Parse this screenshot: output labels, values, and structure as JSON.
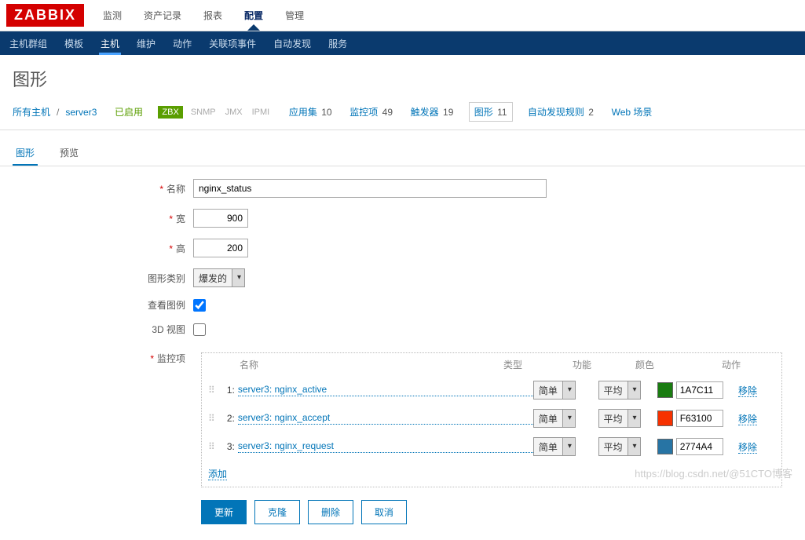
{
  "logo": "ZABBIX",
  "topnav": {
    "items": [
      "监测",
      "资产记录",
      "报表",
      "配置",
      "管理"
    ],
    "active_index": 3
  },
  "subnav": {
    "items": [
      "主机群组",
      "模板",
      "主机",
      "维护",
      "动作",
      "关联项事件",
      "自动发现",
      "服务"
    ],
    "active_index": 2
  },
  "page_title": "图形",
  "breadcrumb": {
    "all_hosts": "所有主机",
    "host": "server3",
    "state": "已启用",
    "tags": {
      "zbx": "ZBX",
      "snmp": "SNMP",
      "jmx": "JMX",
      "ipmi": "IPMI"
    },
    "counts": [
      {
        "label": "应用集",
        "value": "10"
      },
      {
        "label": "监控项",
        "value": "49"
      },
      {
        "label": "触发器",
        "value": "19"
      },
      {
        "label": "图形",
        "value": "11",
        "active": true
      },
      {
        "label": "自动发现规则",
        "value": "2"
      },
      {
        "label": "Web 场景",
        "value": ""
      }
    ]
  },
  "tabs": {
    "items": [
      "图形",
      "预览"
    ],
    "active_index": 0
  },
  "form": {
    "name_label": "名称",
    "name_value": "nginx_status",
    "width_label": "宽",
    "width_value": "900",
    "height_label": "高",
    "height_value": "200",
    "type_label": "图形类别",
    "type_value": "爆发的",
    "legend_label": "查看图例",
    "legend_checked": true,
    "view3d_label": "3D 视图",
    "view3d_checked": false,
    "items_label": "监控项",
    "headers": {
      "name": "名称",
      "type": "类型",
      "func": "功能",
      "color": "颜色",
      "action": "动作"
    },
    "type_option": "简单",
    "func_option": "平均",
    "remove_label": "移除",
    "add_label": "添加",
    "items": [
      {
        "idx": "1:",
        "name": "server3: nginx_active",
        "color": "1A7C11"
      },
      {
        "idx": "2:",
        "name": "server3: nginx_accept",
        "color": "F63100"
      },
      {
        "idx": "3:",
        "name": "server3: nginx_request",
        "color": "2774A4"
      }
    ]
  },
  "buttons": {
    "update": "更新",
    "clone": "克隆",
    "delete": "删除",
    "cancel": "取消"
  },
  "watermark": "https://blog.csdn.net/@51CTO博客"
}
